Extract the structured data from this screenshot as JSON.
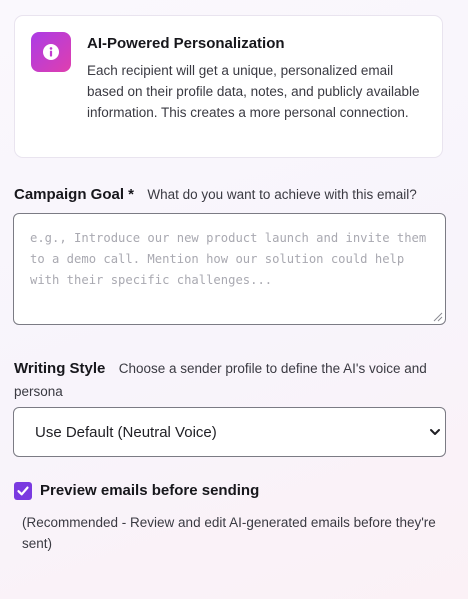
{
  "info_card": {
    "icon": "info-icon",
    "title": "AI-Powered Personalization",
    "body": "Each recipient will get a unique, personalized email based on their profile data, notes, and publicly available information. This creates a more personal connection."
  },
  "campaign_goal": {
    "label": "Campaign Goal *",
    "hint": "What do you want to achieve with this email?",
    "value": "",
    "placeholder": "e.g., Introduce our new product launch and invite them to a demo call. Mention how our solution could help with their specific challenges..."
  },
  "writing_style": {
    "label": "Writing Style",
    "hint": "Choose a sender profile to define the AI's voice and persona",
    "selected": "Use Default (Neutral Voice)"
  },
  "preview": {
    "checked": true,
    "label": "Preview emails before sending",
    "note": "(Recommended - Review and edit AI-generated emails before they're sent)"
  },
  "colors": {
    "accent": "#7a3ae0",
    "badge_gradient_start": "#ab3ce6",
    "badge_gradient_end": "#df3fae"
  }
}
